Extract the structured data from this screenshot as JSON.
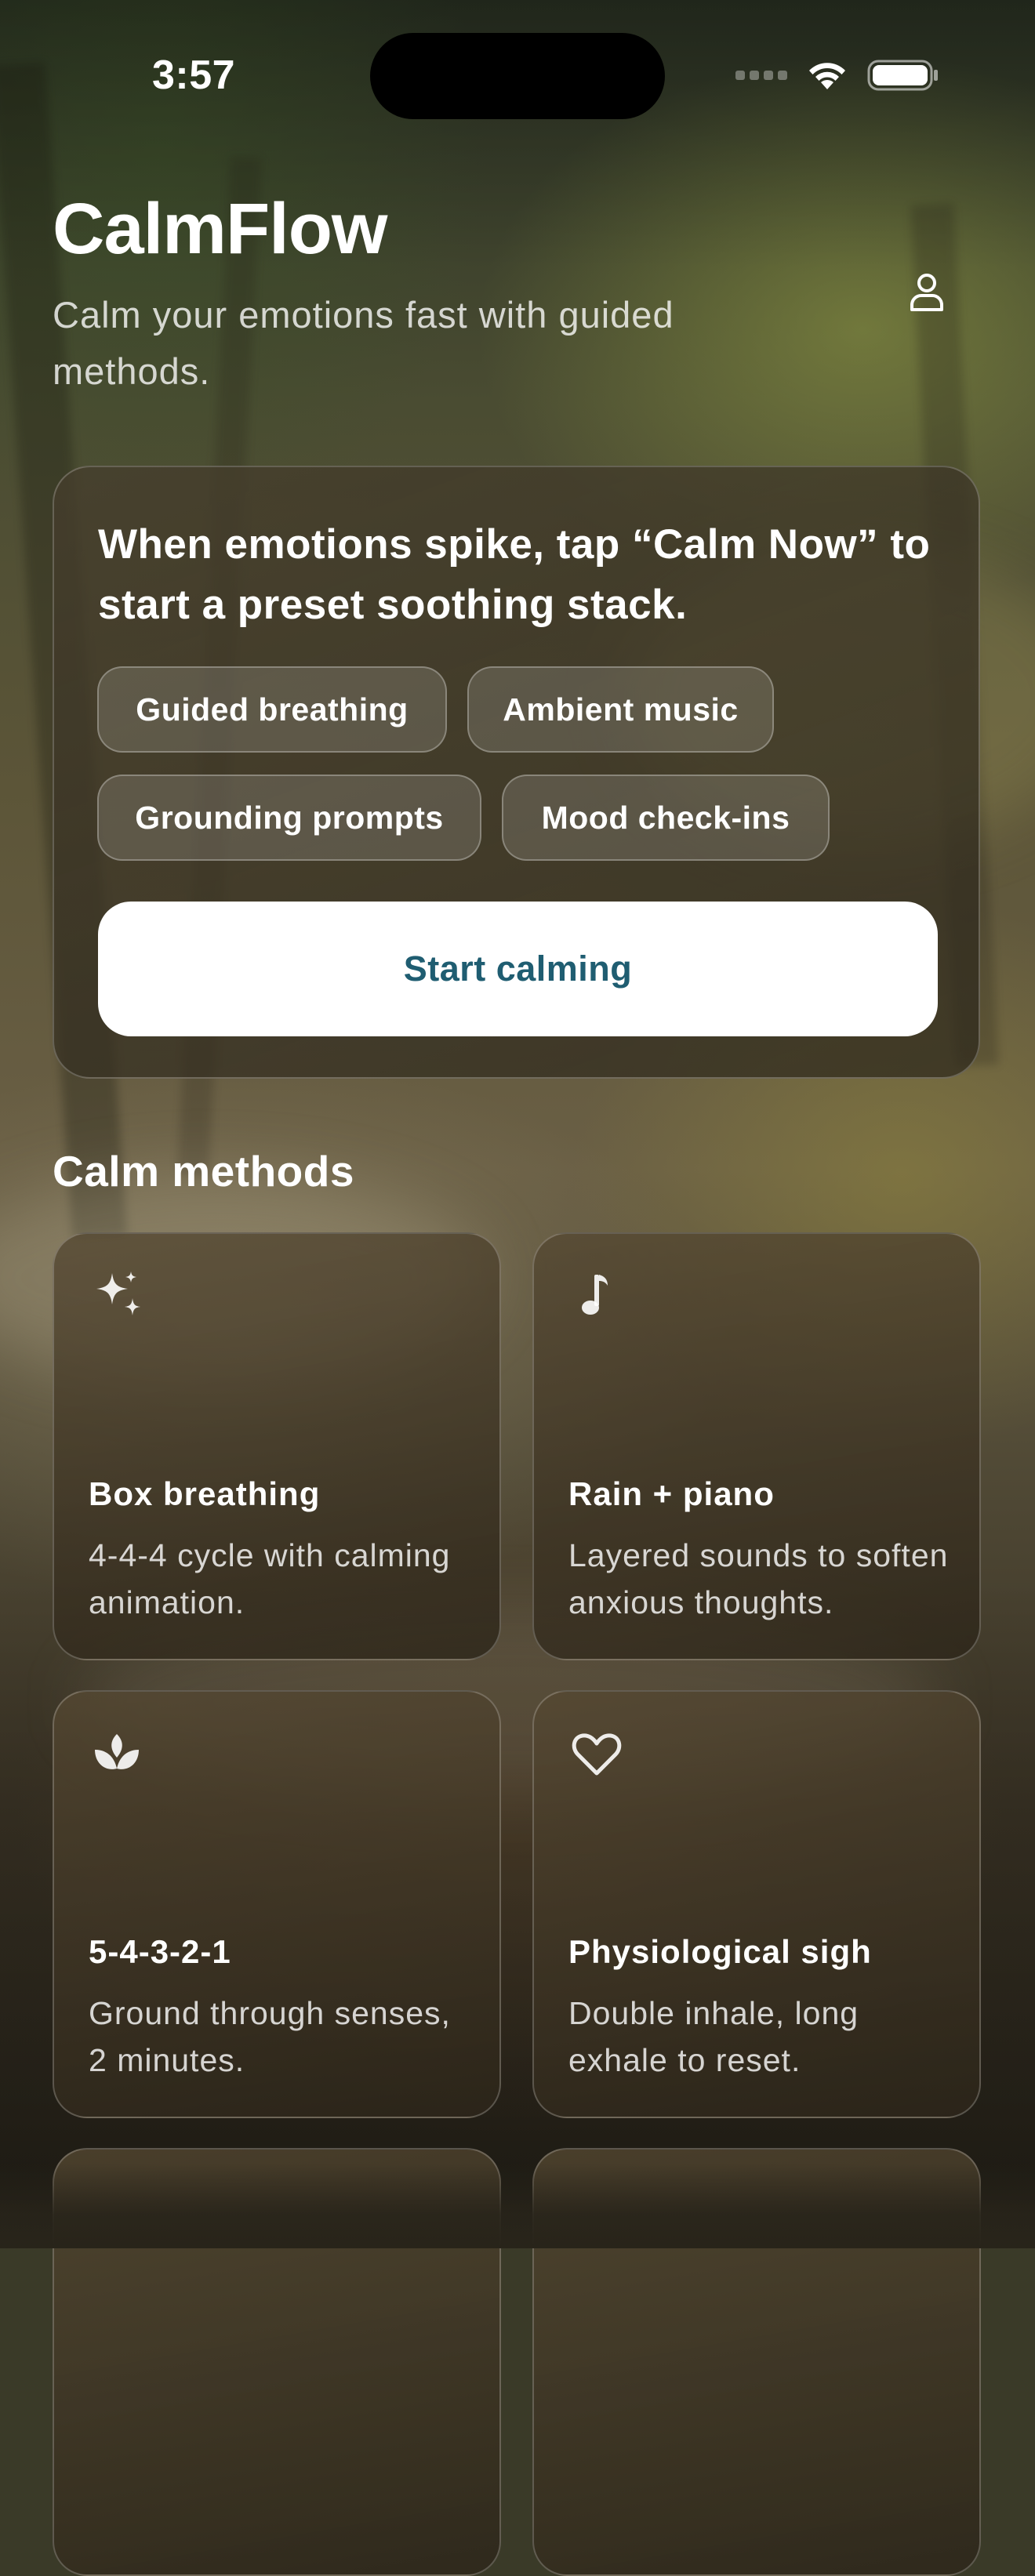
{
  "status_bar": {
    "time": "3:57"
  },
  "header": {
    "title": "CalmFlow",
    "subtitle": "Calm your emotions fast with guided methods.",
    "profile_icon": "person-icon"
  },
  "hero": {
    "text": "When emotions spike, tap “Calm Now” to start a preset soothing stack.",
    "chips": [
      {
        "label": "Guided breathing"
      },
      {
        "label": "Ambient music"
      },
      {
        "label": "Grounding prompts"
      },
      {
        "label": "Mood check-ins"
      }
    ],
    "cta_label": "Start calming",
    "cta_color": "#1f5d71"
  },
  "methods": {
    "title": "Calm methods",
    "items": [
      {
        "icon": "sparkles-icon",
        "title": "Box breathing",
        "description": "4-4-4 cycle with calming animation."
      },
      {
        "icon": "music-note-icon",
        "title": "Rain + piano",
        "description": "Layered sounds to soften anxious thoughts."
      },
      {
        "icon": "lotus-icon",
        "title": "5-4-3-2-1",
        "description": "Ground through senses, 2 minutes."
      },
      {
        "icon": "heart-icon",
        "title": "Physiological sigh",
        "description": "Double inhale, long exhale to reset."
      }
    ]
  }
}
